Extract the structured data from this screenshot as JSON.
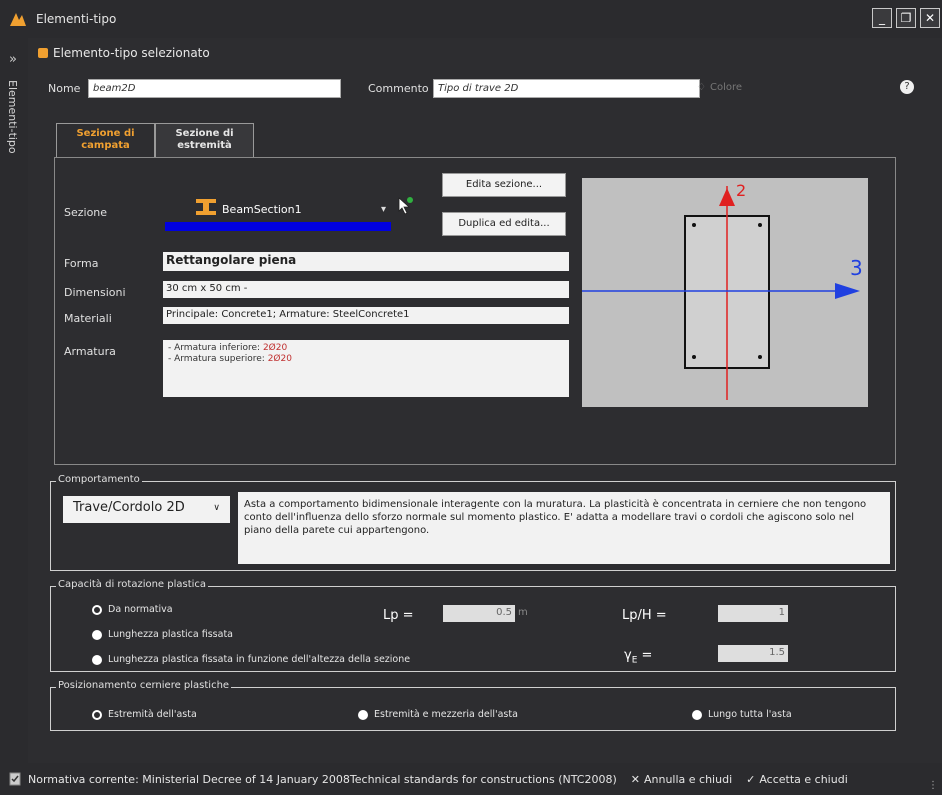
{
  "window": {
    "title": "Elementi-tipo",
    "btn_minimize": "_",
    "btn_restore": "❐",
    "btn_close": "✕"
  },
  "side": {
    "label": "Elementi-tipo"
  },
  "panel": {
    "heading": "Elemento-tipo selezionato",
    "nome_label": "Nome",
    "nome_value": "beam2D",
    "commento_label": "Commento",
    "commento_value": "Tipo di trave 2D",
    "colore_label": "Colore",
    "help": "?"
  },
  "tabs": [
    {
      "label": "Sezione di campata",
      "active": true
    },
    {
      "label": "Sezione di estremità",
      "active": false
    }
  ],
  "section": {
    "sezione_label": "Sezione",
    "sezione_value": "BeamSection1",
    "btn_edita": "Edita sezione...",
    "btn_duplica": "Duplica ed edita...",
    "forma_label": "Forma",
    "forma_value": "Rettangolare piena",
    "dimensioni_label": "Dimensioni",
    "dimensioni_value": "30 cm x 50 cm -",
    "materiali_label": "Materiali",
    "materiali_value": "Principale: Concrete1; Armature: SteelConcrete1",
    "armatura_label": "Armatura",
    "armatura_line1_prefix": "- Armatura inferiore: ",
    "armatura_line1_value": "2Ø20",
    "armatura_line2_prefix": "- Armatura superiore: ",
    "armatura_line2_value": "2Ø20",
    "preview_axis_2": "2",
    "preview_axis_3": "3"
  },
  "comportamento": {
    "title": "Comportamento",
    "selected": "Trave/Cordolo 2D",
    "description": "Asta a comportamento bidimensionale interagente con la muratura. La plasticità è concentrata in cerniere che non tengono conto dell'influenza dello sforzo normale sul momento plastico. E' adatta a modellare travi o cordoli che agiscono solo nel piano della parete cui appartengono."
  },
  "capacita": {
    "title": "Capacità di rotazione plastica",
    "options": [
      {
        "label": "Da normativa",
        "selected": true
      },
      {
        "label": "Lunghezza plastica fissata",
        "selected": false
      },
      {
        "label": "Lunghezza plastica fissata in funzione dell'altezza della sezione",
        "selected": false
      }
    ],
    "lp_label": "Lp =",
    "lp_value": "0.5",
    "lp_unit": "m",
    "lph_label": "Lp/H =",
    "lph_value": "1",
    "gamma_label": "γ",
    "gamma_sub": "E",
    "gamma_eq": "=",
    "gamma_value": "1.5"
  },
  "posizionamento": {
    "title": "Posizionamento cerniere plastiche",
    "options": [
      {
        "label": "Estremità dell'asta",
        "selected": true
      },
      {
        "label": "Estremità e mezzeria dell'asta",
        "selected": false
      },
      {
        "label": "Lungo tutta l'asta",
        "selected": false
      }
    ]
  },
  "status": {
    "normativa": "Normativa corrente:  Ministerial Decree of 14 January 2008Technical standards for constructions (NTC2008)",
    "annulla": "Annulla e chiudi",
    "accetta": "Accetta e chiudi"
  },
  "colors": {
    "accent_orange": "#f0a030",
    "section_blue": "#0000e0",
    "axis_red": "#e02020",
    "axis_blue": "#2040e0"
  }
}
